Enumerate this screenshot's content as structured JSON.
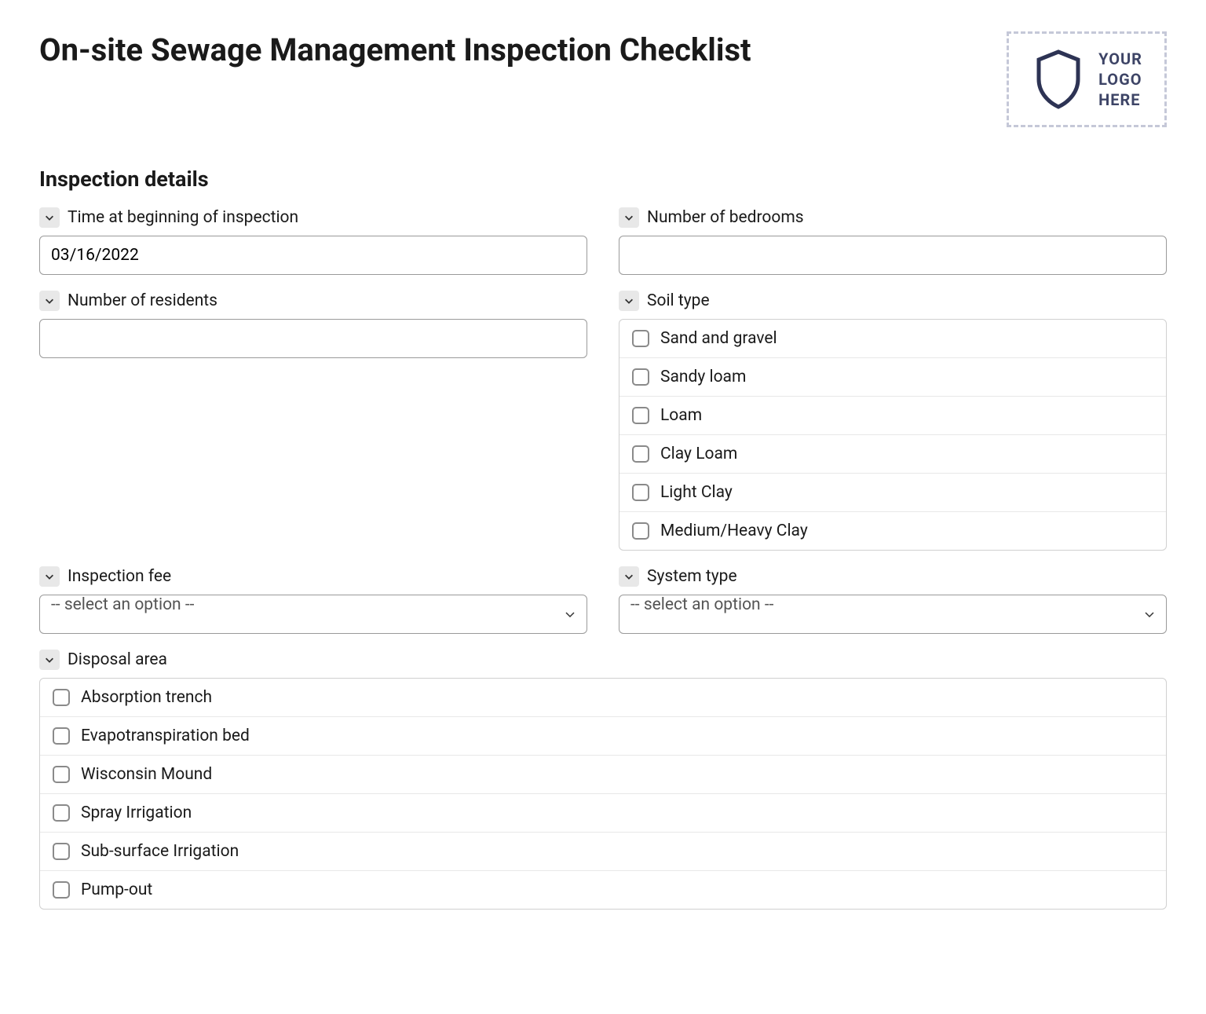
{
  "page": {
    "title": "On-site Sewage Management Inspection Checklist"
  },
  "logo": {
    "line1": "YOUR",
    "line2": "LOGO",
    "line3": "HERE"
  },
  "section": {
    "inspection_details": "Inspection details"
  },
  "fields": {
    "time_beginning": {
      "label": "Time at beginning of inspection",
      "value": "03/16/2022"
    },
    "number_bedrooms": {
      "label": "Number of bedrooms",
      "value": ""
    },
    "number_residents": {
      "label": "Number of residents",
      "value": ""
    },
    "soil_type": {
      "label": "Soil type",
      "options": [
        "Sand and gravel",
        "Sandy loam",
        "Loam",
        "Clay Loam",
        "Light Clay",
        "Medium/Heavy Clay"
      ]
    },
    "inspection_fee": {
      "label": "Inspection fee",
      "placeholder": "-- select an option --"
    },
    "system_type": {
      "label": "System type",
      "placeholder": "-- select an option --"
    },
    "disposal_area": {
      "label": "Disposal area",
      "options": [
        "Absorption trench",
        "Evapotranspiration bed",
        "Wisconsin Mound",
        "Spray Irrigation",
        "Sub-surface Irrigation",
        "Pump-out"
      ]
    }
  }
}
